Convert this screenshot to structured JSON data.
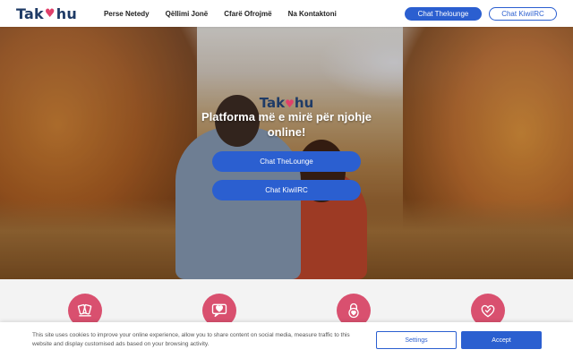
{
  "header": {
    "logo_left": "Tak",
    "logo_right": "hu",
    "nav": [
      "Perse Netedy",
      "Qëllimi Jonë",
      "Cfarë Ofrojmë",
      "Na Kontaktoni"
    ],
    "btn_thelounge": "Chat Thelounge",
    "btn_kiwiirc": "Chat KiwiIRC"
  },
  "hero": {
    "logo_left": "Tak",
    "logo_right": "hu",
    "title": "Platforma më e mirë për njohje online!",
    "btn_thelounge": "Chat TheLounge",
    "btn_kiwiirc": "Chat KiwiIRC"
  },
  "features": {
    "icons": [
      "hand-cards-icon",
      "chat-heart-icon",
      "lock-heart-icon",
      "check-heart-icon"
    ],
    "icon_color": "#d9506f"
  },
  "cookie": {
    "text": "This site uses cookies to improve your online experience, allow you to share content on social media, measure traffic to this website and display customised ads based on your browsing activity.",
    "settings_label": "Settings",
    "accept_label": "Accept"
  },
  "colors": {
    "accent": "#2b5fd0",
    "brand_dark": "#1f3b66",
    "heart": "#e0406a"
  }
}
